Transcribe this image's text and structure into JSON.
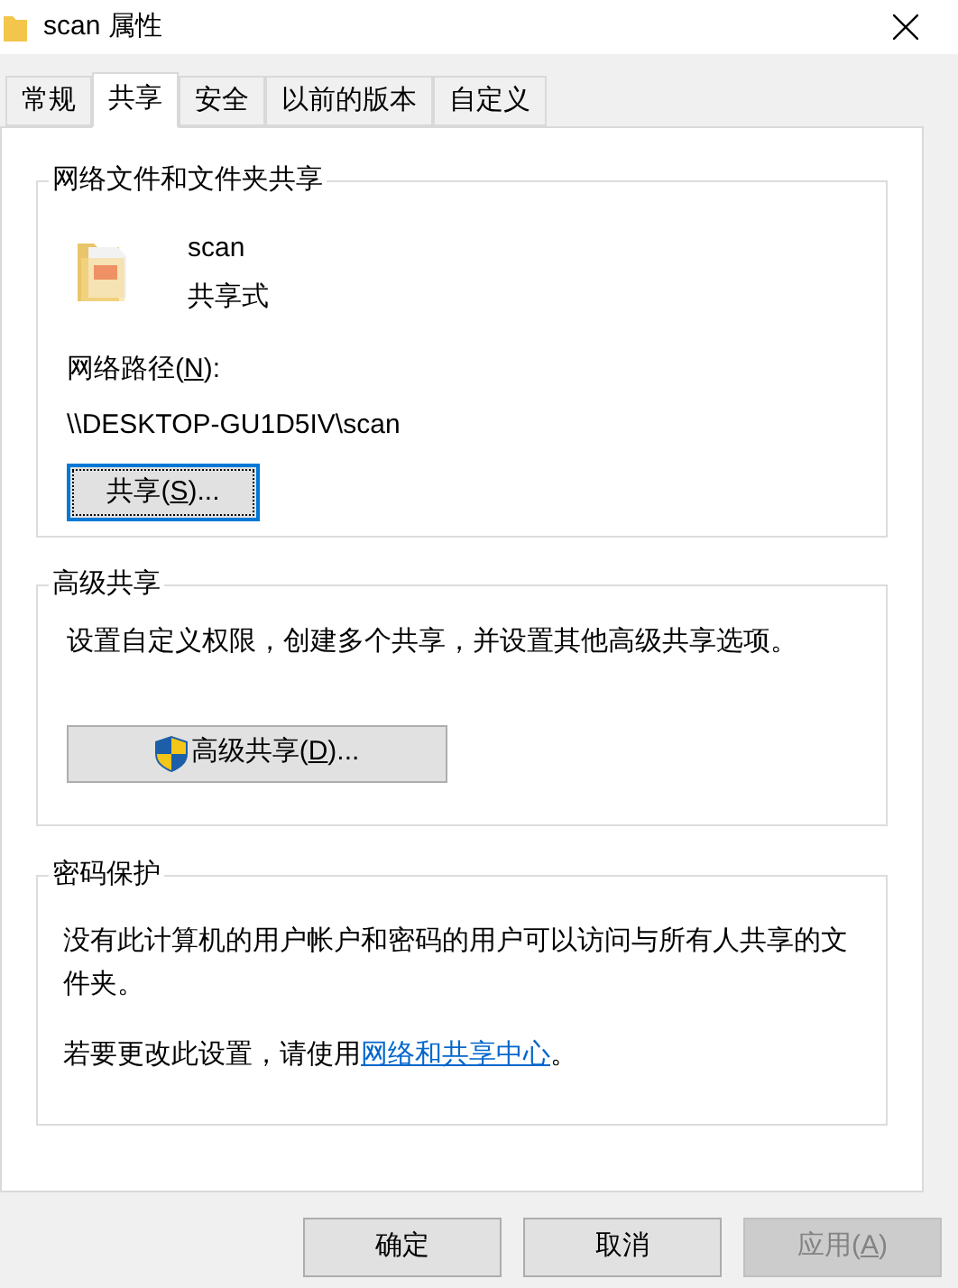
{
  "window": {
    "title": "scan 属性"
  },
  "tabs": [
    {
      "label": "常规",
      "selected": false
    },
    {
      "label": "共享",
      "selected": true
    },
    {
      "label": "安全",
      "selected": false
    },
    {
      "label": "以前的版本",
      "selected": false
    },
    {
      "label": "自定义",
      "selected": false
    }
  ],
  "network_sharing": {
    "title": "网络文件和文件夹共享",
    "item_name": "scan",
    "item_state": "共享式",
    "path_label_parts": [
      "网络路径(",
      "N",
      "):"
    ],
    "path": "\\\\DESKTOP-GU1D5IV\\scan",
    "button_parts": [
      "共享(",
      "S",
      ")..."
    ]
  },
  "advanced_sharing": {
    "title": "高级共享",
    "description": "设置自定义权限，创建多个共享，并设置其他高级共享选项。",
    "button_parts": [
      "高级共享(",
      "D",
      ")..."
    ]
  },
  "password_protection": {
    "title": "密码保护",
    "description": "没有此计算机的用户帐户和密码的用户可以访问与所有人共享的文件夹。",
    "hint": "若要更改此设置，请使用",
    "link": "网络和共享中心",
    "hint_end": "。"
  },
  "buttons": [
    {
      "label_parts": [
        "确定"
      ],
      "disabled": false
    },
    {
      "label_parts": [
        "取消"
      ],
      "disabled": false
    },
    {
      "label_parts": [
        "应用(",
        "A",
        ")"
      ],
      "disabled": true
    }
  ]
}
